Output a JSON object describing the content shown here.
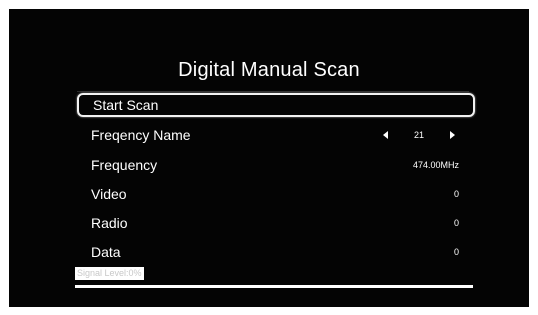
{
  "title": "Digital Manual Scan",
  "menu": {
    "start_scan": "Start Scan",
    "frequency_name": {
      "label": "Freqency Name",
      "value": "21"
    },
    "frequency": {
      "label": "Frequency",
      "value": "474.00MHz"
    },
    "video": {
      "label": "Video",
      "value": "0"
    },
    "radio": {
      "label": "Radio",
      "value": "0"
    },
    "data": {
      "label": "Data",
      "value": "0"
    }
  },
  "signal": {
    "label": "Signal Level:0%",
    "level_percent": 0
  },
  "icons": {
    "prev": "left-arrow-icon",
    "next": "right-arrow-icon"
  },
  "colors": {
    "background": "#040404",
    "text": "#ffffff",
    "focus_border": "#f2f2f2"
  }
}
